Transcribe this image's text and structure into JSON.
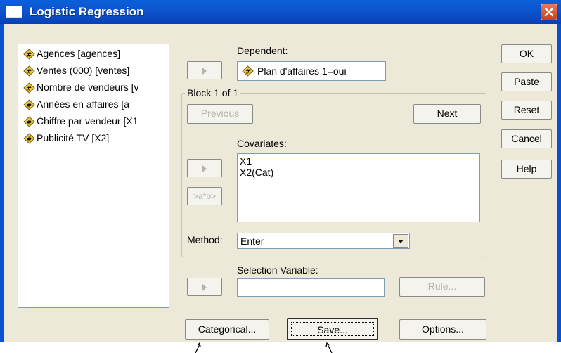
{
  "window": {
    "title": "Logistic Regression"
  },
  "variables": [
    {
      "label": "Agences [agences]"
    },
    {
      "label": "Ventes (000)  [ventes]"
    },
    {
      "label": "Nombre de vendeurs [v"
    },
    {
      "label": "Années  en  affaires [a"
    },
    {
      "label": "Chiffre par vendeur [X1"
    },
    {
      "label": "Publicité TV [X2]"
    }
  ],
  "dependent": {
    "label": "Dependent:",
    "value": "Plan d'affaires  1=oui"
  },
  "block": {
    "label": "Block 1 of 1",
    "previous": "Previous",
    "next": "Next"
  },
  "covariates": {
    "label": "Covariates:",
    "items": [
      "X1",
      "X2(Cat)"
    ],
    "interaction": ">a*b>"
  },
  "method": {
    "label": "Method:",
    "value": "Enter"
  },
  "selection": {
    "label": "Selection Variable:",
    "rule": "Rule..."
  },
  "right_buttons": [
    "OK",
    "Paste",
    "Reset",
    "Cancel",
    "Help"
  ],
  "bottom_buttons": [
    "Categorical...",
    "Save...",
    "Options..."
  ]
}
